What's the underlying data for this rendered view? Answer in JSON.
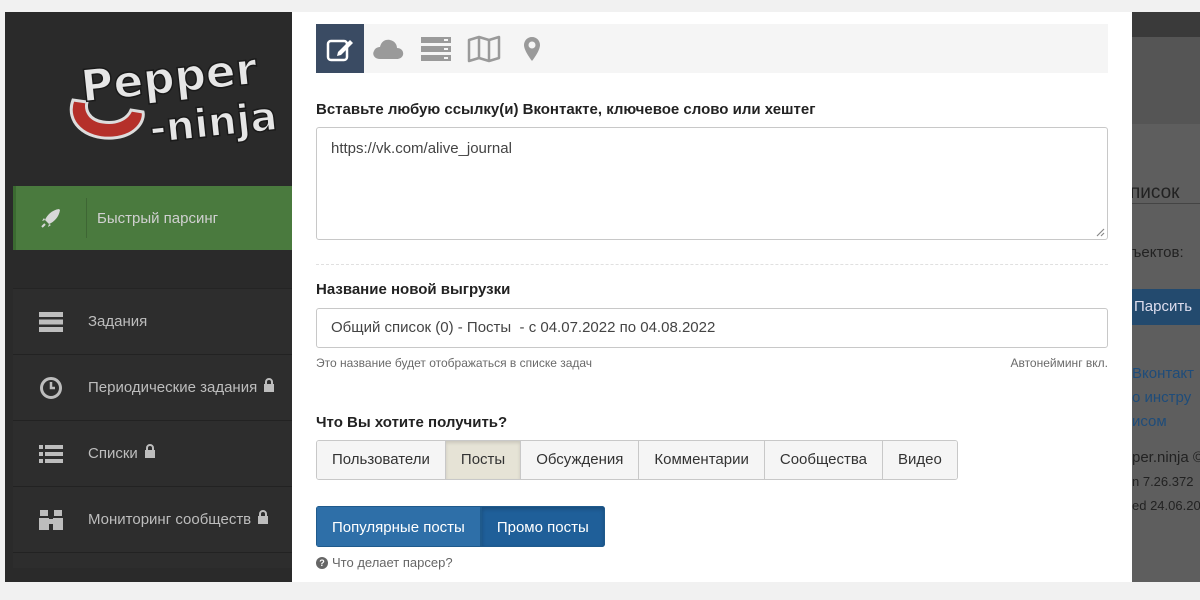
{
  "sidebar": {
    "logo_line1": "Pepper",
    "logo_line2": "-ninja",
    "quick_parse_label": "Быстрый парсинг",
    "items": [
      {
        "label": "Задания",
        "icon": "server-icon",
        "locked": false
      },
      {
        "label": "Периодические задания",
        "icon": "clock-icon",
        "locked": true
      },
      {
        "label": "Списки",
        "icon": "list-icon",
        "locked": true
      },
      {
        "label": "Мониторинг сообществ",
        "icon": "binoculars-icon",
        "locked": true
      }
    ]
  },
  "background_right": {
    "fragment_1": "писок",
    "fragment_2": "ъектов:",
    "button": "Парсить",
    "fragment_3": "Вконтакт",
    "fragment_4": "о инстру",
    "fragment_5": "исом",
    "fragment_6": "per.ninja ©",
    "fragment_7": "n 7.26.372",
    "fragment_8": "ed 24.06.20"
  },
  "modal": {
    "toolbar_icons": [
      "edit-icon",
      "cloud-icon",
      "database-icon",
      "map-icon",
      "map-marker-icon"
    ],
    "link_label": "Вставьте любую ссылку(и) Вконтакте, ключевое слово или хештег",
    "link_value": "https://vk.com/alive_journal",
    "name_label": "Название новой выгрузки",
    "name_value": "Общий список (0) - Посты  - с 04.07.2022 по 04.08.2022",
    "name_hint": "Это название будет отображаться в списке задач",
    "autonaming": "Автонейминг вкл.",
    "what_label": "Что Вы хотите получить?",
    "types": [
      "Пользователи",
      "Посты",
      "Обсуждения",
      "Комментарии",
      "Сообщества",
      "Видео"
    ],
    "selected_type": "Посты",
    "post_modes": [
      "Популярные посты",
      "Промо посты"
    ],
    "helper": "Что делает парсер?"
  },
  "colors": {
    "sidebar_bg": "#2a2a2a",
    "quick_parse_bg": "#4a7a3e",
    "toolbar_active": "#3a4b63",
    "primary_blue": "#2e6fa8"
  }
}
